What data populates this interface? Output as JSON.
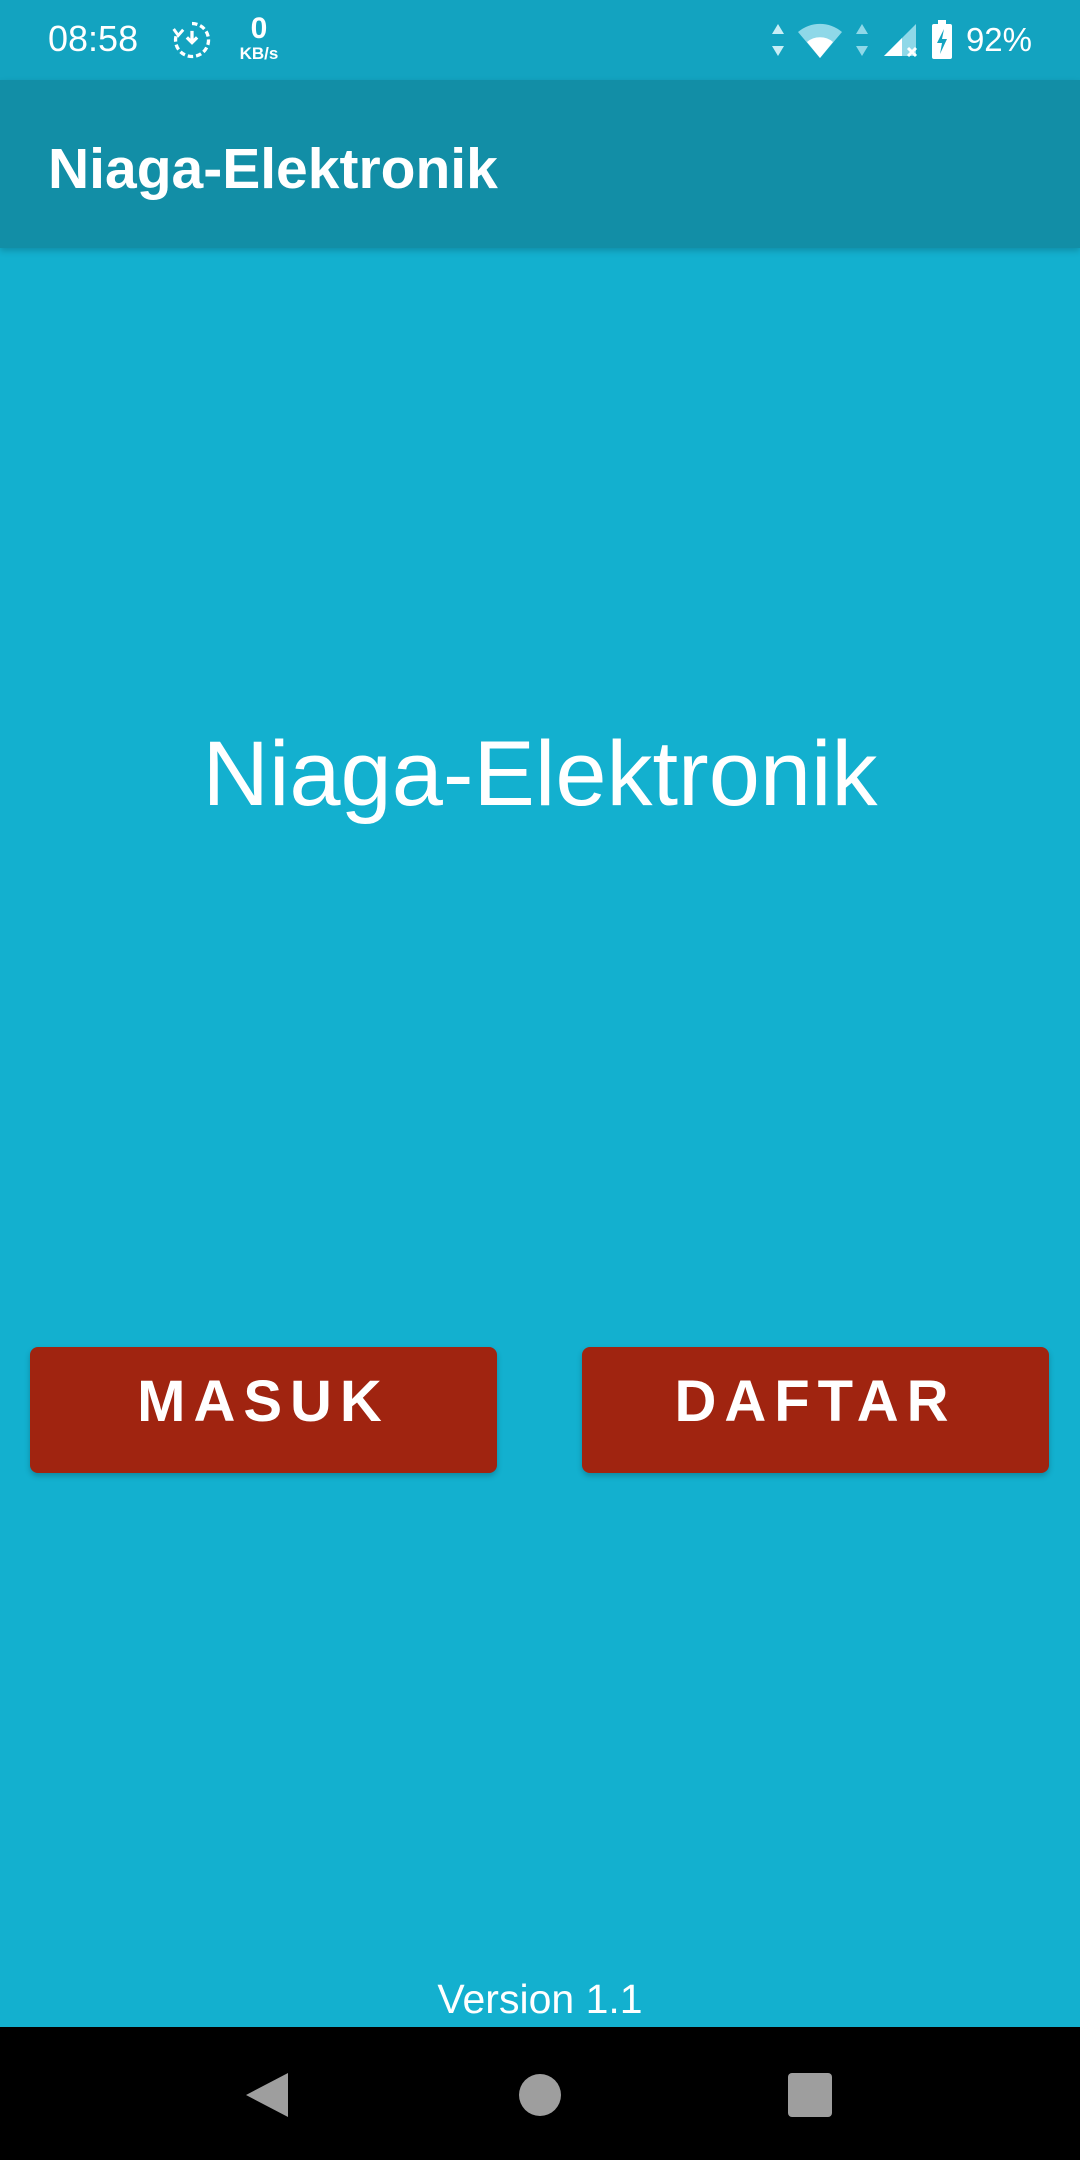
{
  "status_bar": {
    "time": "08:58",
    "net_speed_value": "0",
    "net_speed_unit": "KB/s",
    "battery_percent": "92%",
    "icons": [
      "sync-icon",
      "data-arrows-icon",
      "wifi-icon",
      "cellular-signal-icon",
      "battery-charging-icon"
    ]
  },
  "app_bar": {
    "title": "Niaga-Elektronik"
  },
  "main": {
    "hero_title": "Niaga-Elektronik",
    "login_button": "MASUK",
    "register_button": "DAFTAR",
    "version": "Version 1.1"
  },
  "nav_bar": {
    "icons": [
      "back-icon",
      "home-icon",
      "recents-icon"
    ]
  },
  "colors": {
    "background": "#13b0cf",
    "status_bar": "#13a3c0",
    "app_bar": "#128ea6",
    "button": "#a02410",
    "nav_bar": "#000000",
    "text": "#ffffff"
  }
}
